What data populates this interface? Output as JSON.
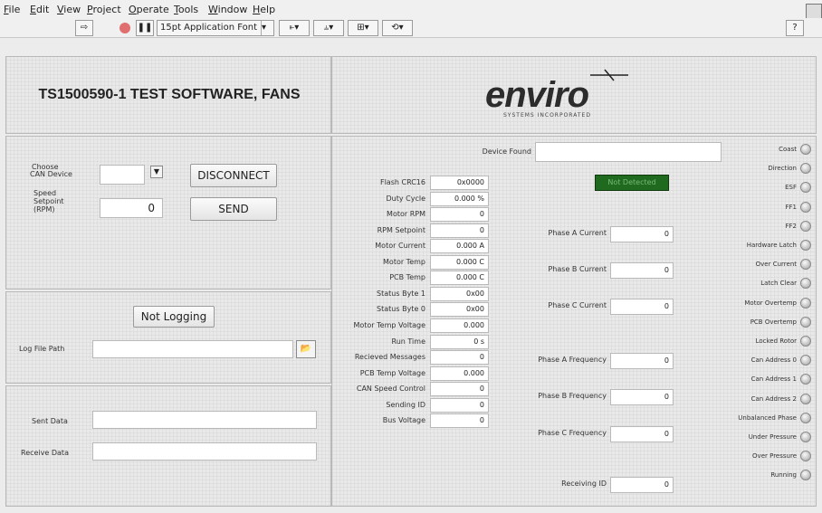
{
  "menu": [
    "File",
    "Edit",
    "View",
    "Project",
    "Operate",
    "Tools",
    "Window",
    "Help"
  ],
  "toolbar": {
    "run_icon": "arrow-run-icon",
    "abort_icon": "stop-icon",
    "pause_icon": "pause-icon",
    "font": "15pt Application Font",
    "help": "?"
  },
  "header": {
    "title": "TS1500590-1 TEST SOFTWARE, FANS",
    "logo_main": "enviro",
    "logo_sub": "SYSTEMS INCORPORATED"
  },
  "connection": {
    "choose_label_1": "Choose",
    "choose_label_2": "CAN Device",
    "speed_label_1": "Speed",
    "speed_label_2": "Setpoint",
    "speed_label_3": "(RPM)",
    "speed_value": "0",
    "disconnect": "DISCONNECT",
    "send": "SEND"
  },
  "logging": {
    "button": "Not Logging",
    "path_label": "Log File Path",
    "path_value": ""
  },
  "data": {
    "sent_label": "Sent Data",
    "sent_value": "",
    "receive_label": "Receive Data",
    "receive_value": ""
  },
  "device": {
    "found_label": "Device Found",
    "found_value": "",
    "status": "Not Detected"
  },
  "readings": [
    {
      "label": "Flash CRC16",
      "value": "0x0000"
    },
    {
      "label": "Duty Cycle",
      "value": "0.000 %"
    },
    {
      "label": "Motor RPM",
      "value": "0"
    },
    {
      "label": "RPM Setpoint",
      "value": "0"
    },
    {
      "label": "Motor Current",
      "value": "0.000 A"
    },
    {
      "label": "Motor Temp",
      "value": "0.000 C"
    },
    {
      "label": "PCB Temp",
      "value": "0.000 C"
    },
    {
      "label": "Status Byte 1",
      "value": "0x00"
    },
    {
      "label": "Status Byte 0",
      "value": "0x00"
    },
    {
      "label": "Motor Temp Voltage",
      "value": "0.000"
    },
    {
      "label": "Run Time",
      "value": "0 s"
    },
    {
      "label": "Recieved Messages",
      "value": "0"
    },
    {
      "label": "PCB Temp Voltage",
      "value": "0.000"
    },
    {
      "label": "CAN Speed Control",
      "value": "0"
    },
    {
      "label": "Sending ID",
      "value": "0"
    },
    {
      "label": "Bus Voltage",
      "value": "0"
    }
  ],
  "phases": [
    {
      "label": "Phase A Current",
      "value": "0"
    },
    {
      "label": "Phase B Current",
      "value": "0"
    },
    {
      "label": "Phase C Current",
      "value": "0"
    },
    {
      "label": "Phase A Frequency",
      "value": "0"
    },
    {
      "label": "Phase B Frequency",
      "value": "0"
    },
    {
      "label": "Phase C Frequency",
      "value": "0"
    },
    {
      "label": "Receiving ID",
      "value": "0"
    }
  ],
  "indicators": [
    "Coast",
    "Direction",
    "ESF",
    "FF1",
    "FF2",
    "Hardware Latch",
    "Over Current",
    "Latch Clear",
    "Motor Overtemp",
    "PCB Overtemp",
    "Locked Rotor",
    "Can Address 0",
    "Can Address 1",
    "Can Address 2",
    "Unbalanced Phase",
    "Under Pressure",
    "Over Pressure",
    "Running"
  ],
  "colors": {
    "status_green": "#1f6a1f"
  }
}
